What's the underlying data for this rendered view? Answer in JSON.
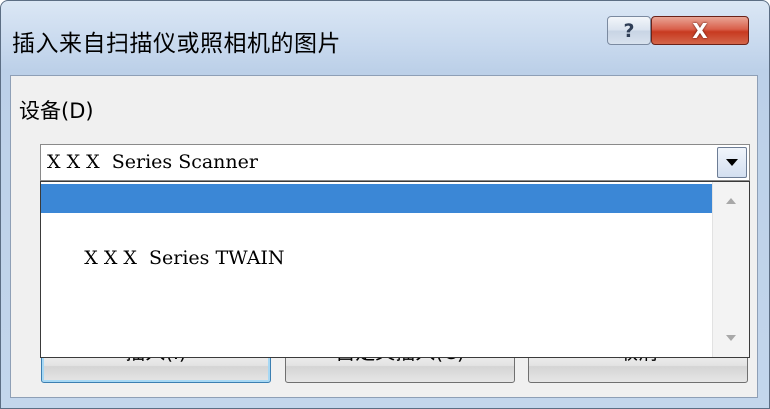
{
  "dialog": {
    "title": "插入来自扫描仪或照相机的图片",
    "help_glyph": "?",
    "close_glyph": "X"
  },
  "device": {
    "label": "设备(D)",
    "selected_value": "X X X  Series Scanner",
    "options": [
      {
        "label": "X X X  Series Scanner",
        "selected": true
      },
      {
        "label": "X X X  Series TWAIN",
        "selected": false
      }
    ]
  },
  "buttons": {
    "insert": "插入(I)",
    "custom_insert": "自定义插入(C)",
    "cancel": "取消"
  },
  "colors": {
    "selection": "#3b87d6",
    "close_button": "#c73a20"
  }
}
